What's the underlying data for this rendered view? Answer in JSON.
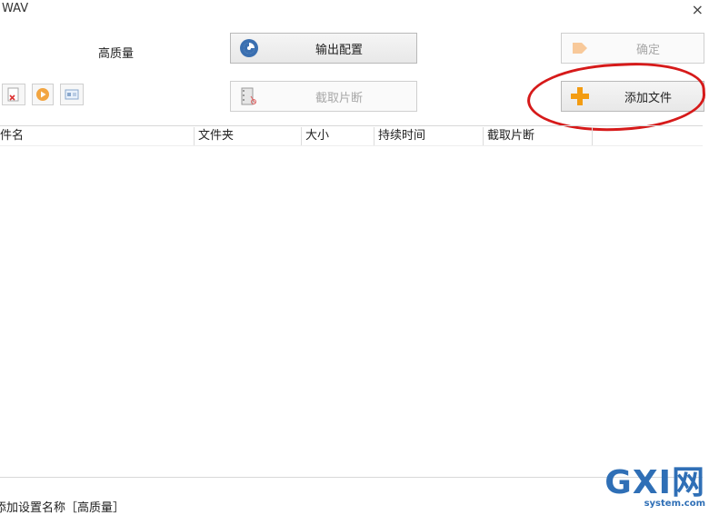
{
  "window": {
    "title": "WAV",
    "close_glyph": "×"
  },
  "preset": {
    "quality_label": "高质量"
  },
  "toolbar": {
    "output_config_label": "输出配置",
    "confirm_label": "确定",
    "clip_label": "截取片断",
    "add_file_label": "添加文件"
  },
  "table": {
    "columns": [
      "件名",
      "文件夹",
      "大小",
      "持续时间",
      "截取片断",
      ""
    ]
  },
  "status": {
    "text": "添加设置名称［高质量］"
  },
  "watermark": {
    "brand": "GXI网",
    "site": "system.com"
  },
  "colors": {
    "accent_orange": "#f39c12",
    "annotation_red": "#d61a1a",
    "watermark_blue": "#2f6fb6"
  }
}
